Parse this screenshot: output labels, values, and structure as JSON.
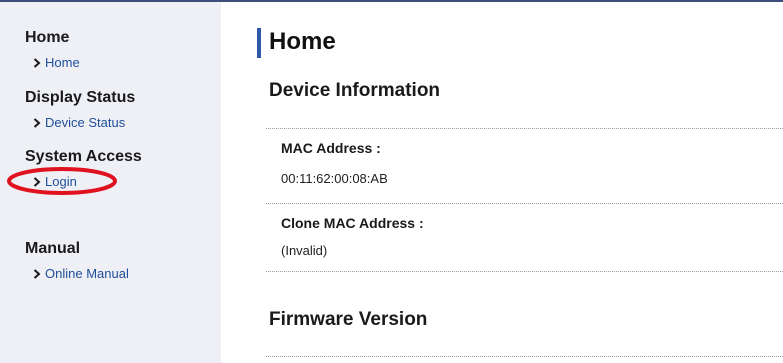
{
  "sidebar": {
    "groups": [
      {
        "heading": "Home",
        "links": [
          "Home"
        ]
      },
      {
        "heading": "Display Status",
        "links": [
          "Device Status"
        ]
      },
      {
        "heading": "System Access",
        "links": [
          "Login"
        ]
      },
      {
        "heading": "Manual",
        "links": [
          "Online Manual"
        ]
      }
    ]
  },
  "main": {
    "page_title": "Home",
    "sections": [
      {
        "title": "Device Information",
        "fields": [
          {
            "label": "MAC Address :",
            "value": "00:11:62:00:08:AB"
          },
          {
            "label": "Clone MAC Address :",
            "value": "(Invalid)"
          }
        ]
      },
      {
        "title": "Firmware Version"
      }
    ]
  },
  "colors": {
    "accent": "#2e5aa8",
    "link": "#1f4e9a",
    "sidebar_bg": "#eef0f6",
    "annotation": "#e0121f"
  }
}
